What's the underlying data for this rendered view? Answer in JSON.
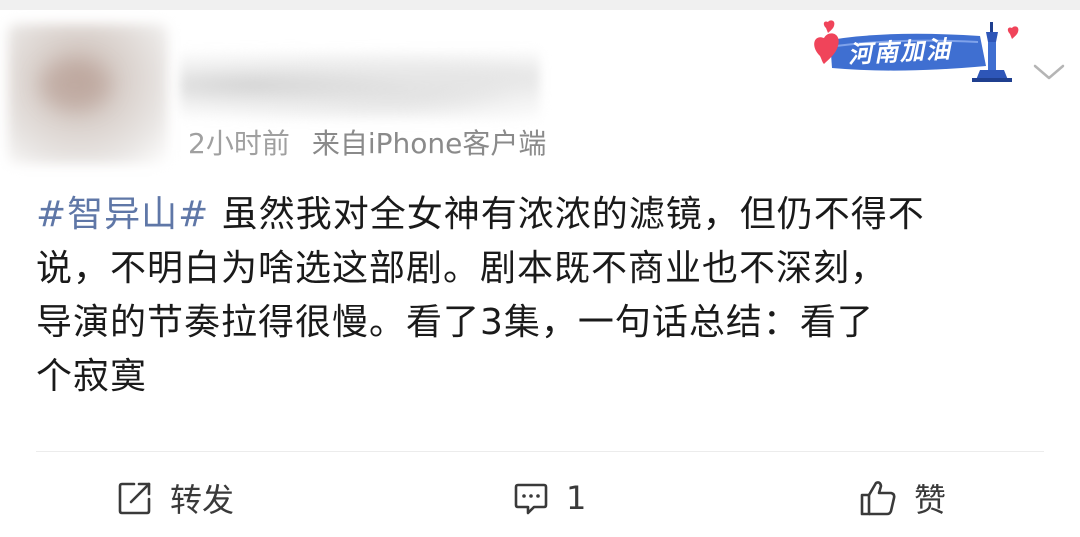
{
  "post": {
    "time": "2小时前",
    "source": "来自iPhone客户端",
    "badge_text": "河南加油",
    "content": {
      "hashtag": "#智异山#",
      "lines": [
        "虽然我对全女神有浓浓的滤镜，但仍不得不",
        "说，不明白为啥选这部剧。剧本既不商业也不深刻，",
        "导演的节奏拉得很慢。看了3集，一句话总结：看了",
        "个寂寞"
      ]
    }
  },
  "actions": {
    "repost_label": "转发",
    "comment_count": "1",
    "like_label": "赞"
  },
  "colors": {
    "hashtag": "#5f77a7",
    "meta": "#8a8a8a",
    "badge_blue": "#3f6fd1",
    "badge_heart": "#f0445a"
  }
}
